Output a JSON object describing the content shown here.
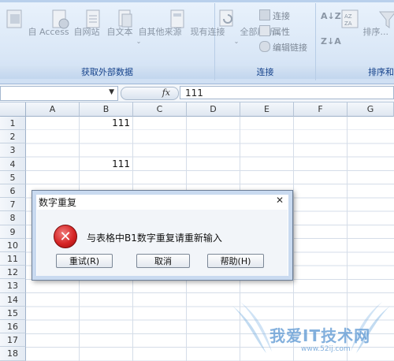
{
  "ribbon": {
    "external_data": {
      "label": "获取外部数据",
      "buttons": [
        "自 Access",
        "自网站",
        "自文本",
        "自其他来源",
        "现有连接"
      ]
    },
    "connections": {
      "label": "连接",
      "refresh_all": "全部刷新",
      "items": [
        "连接",
        "属性",
        "编辑链接"
      ]
    },
    "sort_filter": {
      "label": "排序和",
      "sort": "排序...",
      "filter": "筛选"
    }
  },
  "formula_bar": {
    "name_box": "",
    "fx": "fx",
    "value": "111"
  },
  "grid": {
    "columns": [
      "A",
      "B",
      "C",
      "D",
      "E",
      "F",
      "G"
    ],
    "rows": [
      "1",
      "2",
      "3",
      "4",
      "5",
      "6",
      "7",
      "8",
      "9",
      "10",
      "11",
      "12",
      "13",
      "14",
      "15",
      "16",
      "17",
      "18"
    ],
    "cells": {
      "B1": "111",
      "B4": "111"
    }
  },
  "dialog": {
    "title": "数字重复",
    "close": "✕",
    "message": "与表格中B1数字重复请重新输入",
    "buttons": {
      "retry": "重试(R)",
      "cancel": "取消",
      "help": "帮助(H)"
    }
  },
  "watermark": {
    "main": "我爱IT技术网",
    "sub": "www.52ij.com"
  },
  "colors": {
    "ribbon_label": "#15428b",
    "error_red": "#d62525",
    "grid_line": "#d5dde8"
  }
}
